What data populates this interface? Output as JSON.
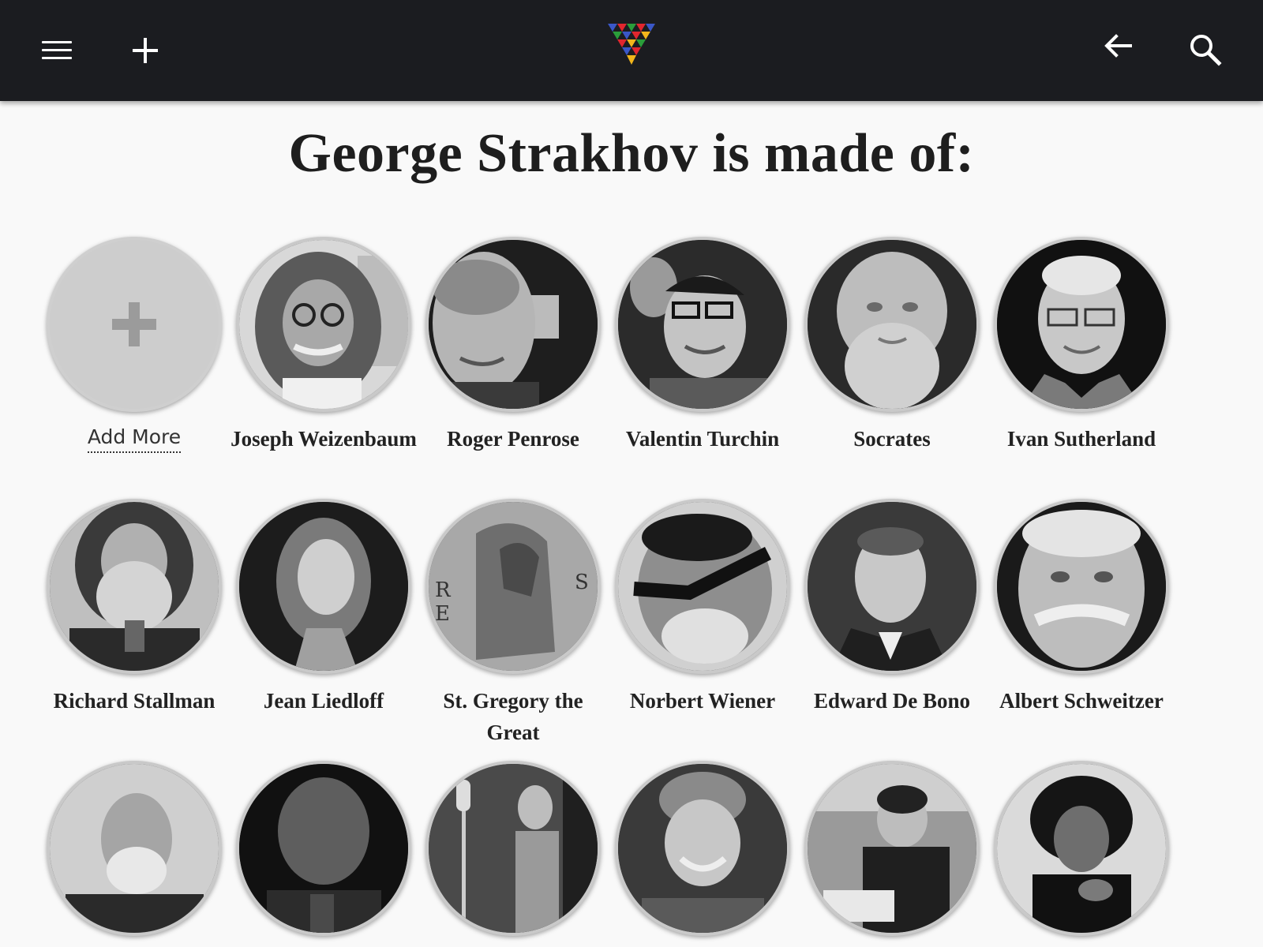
{
  "header": {
    "menu_icon": "hamburger-menu-icon",
    "add_icon": "plus-icon",
    "logo": "triangle-logo",
    "back_icon": "arrow-left-icon",
    "search_icon": "search-icon",
    "background": "#1b1c20"
  },
  "title": "George Strakhov is made of:",
  "add_more": {
    "label": "Add More"
  },
  "people": [
    {
      "name": "Joseph Weizenbaum"
    },
    {
      "name": "Roger Penrose"
    },
    {
      "name": "Valentin Turchin"
    },
    {
      "name": "Socrates"
    },
    {
      "name": "Ivan Sutherland"
    },
    {
      "name": "Richard Stallman"
    },
    {
      "name": "Jean Liedloff"
    },
    {
      "name": "St. Gregory the Great"
    },
    {
      "name": "Norbert Wiener"
    },
    {
      "name": "Edward De Bono"
    },
    {
      "name": "Albert Schweitzer"
    },
    {
      "name": ""
    },
    {
      "name": ""
    },
    {
      "name": ""
    },
    {
      "name": ""
    },
    {
      "name": ""
    },
    {
      "name": ""
    }
  ]
}
